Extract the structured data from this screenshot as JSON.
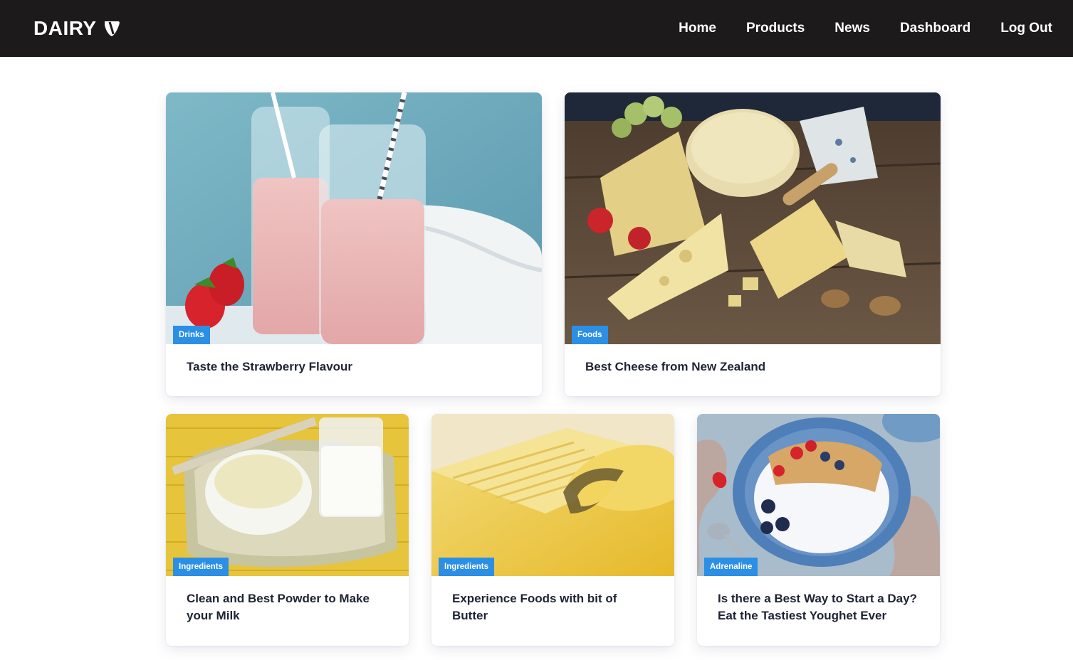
{
  "brand": {
    "name": "DAIRY",
    "logo_icon": "typo3-shield-icon"
  },
  "nav": {
    "items": [
      {
        "label": "Home"
      },
      {
        "label": "Products"
      },
      {
        "label": "News"
      },
      {
        "label": "Dashboard"
      },
      {
        "label": "Log Out"
      }
    ]
  },
  "colors": {
    "topbar": "#1c1a1b",
    "tag": "#2b8fe6",
    "title_text": "#1f2433"
  },
  "cards": [
    {
      "tag": "Drinks",
      "title": "Taste the Strawberry Flavour",
      "image": "strawberry-milkshake-bottles"
    },
    {
      "tag": "Foods",
      "title": "Best Cheese from New Zealand",
      "image": "cheese-platter"
    },
    {
      "tag": "Ingredients",
      "title": "Clean and Best Powder to Make your Milk",
      "image": "milk-powder-and-glass"
    },
    {
      "tag": "Ingredients",
      "title": "Experience Foods with bit of Butter",
      "image": "butter-curl"
    },
    {
      "tag": "Adrenaline",
      "title": "Is there a Best Way to Start a Day? Eat the Tastiest Youghet Ever",
      "image": "yogurt-granola-bowl"
    }
  ]
}
